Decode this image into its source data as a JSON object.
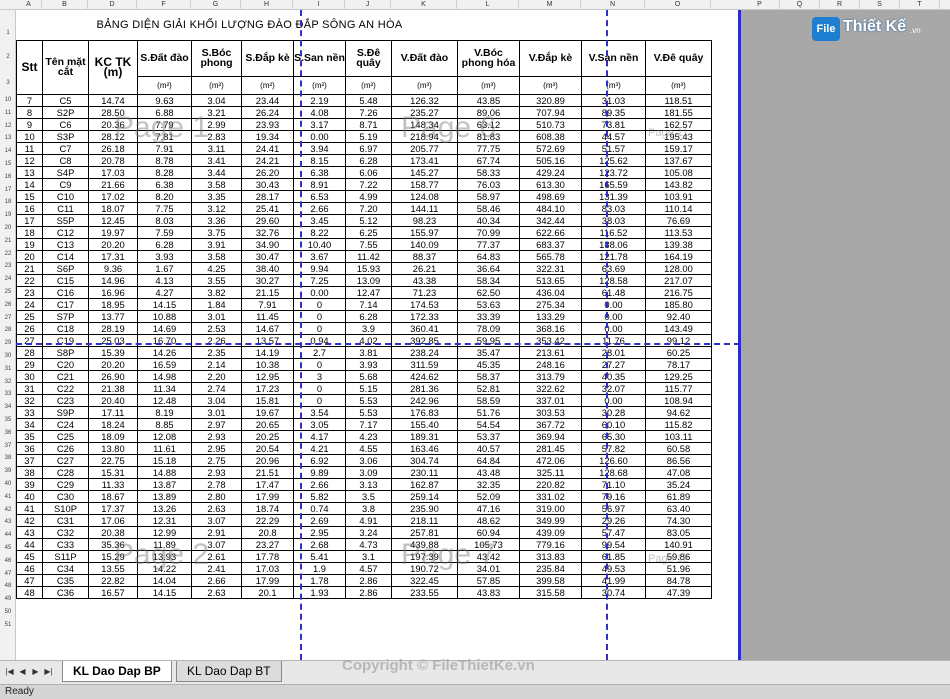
{
  "window": {
    "logo_badge": "File",
    "logo_text": "Thiết Kế",
    "logo_suffix": ".vn",
    "copyright": "Copyright © FileThietKe.vn"
  },
  "columns": [
    "A",
    "B",
    "D",
    "F",
    "G",
    "H",
    "I",
    "J",
    "K",
    "L",
    "M",
    "N",
    "O",
    "P",
    "Q",
    "R",
    "S",
    "T"
  ],
  "title": "BẢNG DIỆN GIẢI KHỐI LƯỢNG ĐÀO ĐẮP SÔNG AN HÒA",
  "headers": [
    "Stt",
    "Tên mặt cắt",
    "KC TK (m)",
    "S.Đất đào",
    "S.Bóc phong",
    "S.Đắp kè",
    "S.San nền",
    "S.Đê quây",
    "V.Đất đào",
    "V.Bóc phong hóa",
    "V.Đắp kè",
    "V.San nền",
    "V.Đê quây"
  ],
  "units": [
    "",
    "",
    "",
    "(m²)",
    "(m²)",
    "(m²)",
    "(m²)",
    "(m²)",
    "(m³)",
    "(m³)",
    "(m³)",
    "(m³)",
    "(m³)"
  ],
  "row_numbers": [
    "1",
    "2",
    "3",
    "10",
    "11",
    "12",
    "13",
    "14",
    "15",
    "16",
    "17",
    "18",
    "19",
    "20",
    "21",
    "22",
    "23",
    "24",
    "25",
    "26",
    "27",
    "28",
    "29",
    "30",
    "31",
    "32",
    "33",
    "34",
    "35",
    "36",
    "37",
    "38",
    "39",
    "40",
    "41",
    "42",
    "43",
    "44",
    "45",
    "46",
    "47",
    "48",
    "49",
    "50",
    "51"
  ],
  "rows": [
    [
      "7",
      "C5",
      "14.74",
      "9.63",
      "3.04",
      "23.44",
      "2.19",
      "5.48",
      "126.32",
      "43.85",
      "320.89",
      "31.03",
      "118.51"
    ],
    [
      "8",
      "S2P",
      "28.50",
      "6.88",
      "3.21",
      "26.24",
      "4.08",
      "7.26",
      "235.27",
      "89.06",
      "707.94",
      "89.35",
      "181.55"
    ],
    [
      "9",
      "C6",
      "20.36",
      "7.79",
      "2.99",
      "23.93",
      "3.17",
      "8.71",
      "148.34",
      "63.12",
      "510.73",
      "73.81",
      "162.57"
    ],
    [
      "10",
      "S3P",
      "28.12",
      "7.81",
      "2.83",
      "19.34",
      "0.00",
      "5.19",
      "218.94",
      "81.83",
      "608.38",
      "44.57",
      "195.43"
    ],
    [
      "11",
      "C7",
      "26.18",
      "7.91",
      "3.11",
      "24.41",
      "3.94",
      "6.97",
      "205.77",
      "77.75",
      "572.69",
      "51.57",
      "159.17"
    ],
    [
      "12",
      "C8",
      "20.78",
      "8.78",
      "3.41",
      "24.21",
      "8.15",
      "6.28",
      "173.41",
      "67.74",
      "505.16",
      "125.62",
      "137.67"
    ],
    [
      "13",
      "S4P",
      "17.03",
      "8.28",
      "3.44",
      "26.20",
      "6.38",
      "6.06",
      "145.27",
      "58.33",
      "429.24",
      "123.72",
      "105.08"
    ],
    [
      "14",
      "C9",
      "21.66",
      "6.38",
      "3.58",
      "30.43",
      "8.91",
      "7.22",
      "158.77",
      "76.03",
      "613.30",
      "165.59",
      "143.82"
    ],
    [
      "15",
      "C10",
      "17.02",
      "8.20",
      "3.35",
      "28.17",
      "6.53",
      "4.99",
      "124.08",
      "58.97",
      "498.69",
      "131.39",
      "103.91"
    ],
    [
      "16",
      "C11",
      "18.07",
      "7.75",
      "3.12",
      "25.41",
      "2.66",
      "7.20",
      "144.11",
      "58.46",
      "484.10",
      "83.03",
      "110.14"
    ],
    [
      "17",
      "S5P",
      "12.45",
      "8.03",
      "3.36",
      "29.60",
      "3.45",
      "5.12",
      "98.23",
      "40.34",
      "342.44",
      "38.03",
      "76.69"
    ],
    [
      "18",
      "C12",
      "19.97",
      "7.59",
      "3.75",
      "32.76",
      "8.22",
      "6.25",
      "155.97",
      "70.99",
      "622.66",
      "116.52",
      "113.53"
    ],
    [
      "19",
      "C13",
      "20.20",
      "6.28",
      "3.91",
      "34.90",
      "10.40",
      "7.55",
      "140.09",
      "77.37",
      "683.37",
      "188.06",
      "139.38"
    ],
    [
      "20",
      "C14",
      "17.31",
      "3.93",
      "3.58",
      "30.47",
      "3.67",
      "11.42",
      "88.37",
      "64.83",
      "565.78",
      "121.78",
      "164.19"
    ],
    [
      "21",
      "S6P",
      "9.36",
      "1.67",
      "4.25",
      "38.40",
      "9.94",
      "15.93",
      "26.21",
      "36.64",
      "322.31",
      "63.69",
      "128.00"
    ],
    [
      "22",
      "C15",
      "14.96",
      "4.13",
      "3.55",
      "30.27",
      "7.25",
      "13.09",
      "43.38",
      "58.34",
      "513.65",
      "128.58",
      "217.07"
    ],
    [
      "23",
      "C16",
      "16.96",
      "4.27",
      "3.82",
      "21.15",
      "0.00",
      "12.47",
      "71.23",
      "62.50",
      "436.04",
      "61.48",
      "216.75"
    ],
    [
      "24",
      "C17",
      "18.95",
      "14.15",
      "1.84",
      "7.91",
      "0",
      "7.14",
      "174.53",
      "53.63",
      "275.34",
      "0.00",
      "185.80"
    ],
    [
      "25",
      "S7P",
      "13.77",
      "10.88",
      "3.01",
      "11.45",
      "0",
      "6.28",
      "172.33",
      "33.39",
      "133.29",
      "0.00",
      "92.40"
    ],
    [
      "26",
      "C18",
      "28.19",
      "14.69",
      "2.53",
      "14.67",
      "0",
      "3.9",
      "360.41",
      "78.09",
      "368.16",
      "0.00",
      "143.49"
    ],
    [
      "27",
      "C19",
      "25.03",
      "16.70",
      "2.26",
      "13.57",
      "0.94",
      "4.02",
      "392.85",
      "59.95",
      "353.42",
      "11.76",
      "99.12"
    ],
    [
      "28",
      "S8P",
      "15.39",
      "14.26",
      "2.35",
      "14.19",
      "2.7",
      "3.81",
      "238.24",
      "35.47",
      "213.61",
      "28.01",
      "60.25"
    ],
    [
      "29",
      "C20",
      "20.20",
      "16.59",
      "2.14",
      "10.38",
      "0",
      "3.93",
      "311.59",
      "45.35",
      "248.16",
      "27.27",
      "78.17"
    ],
    [
      "30",
      "C21",
      "26.90",
      "14.98",
      "2.20",
      "12.95",
      "3",
      "5.68",
      "424.62",
      "58.37",
      "313.79",
      "40.35",
      "129.25"
    ],
    [
      "31",
      "C22",
      "21.38",
      "11.34",
      "2.74",
      "17.23",
      "0",
      "5.15",
      "281.36",
      "52.81",
      "322.62",
      "32.07",
      "115.77"
    ],
    [
      "32",
      "C23",
      "20.40",
      "12.48",
      "3.04",
      "15.81",
      "0",
      "5.53",
      "242.96",
      "58.59",
      "337.01",
      "0.00",
      "108.94"
    ],
    [
      "33",
      "S9P",
      "17.11",
      "8.19",
      "3.01",
      "19.67",
      "3.54",
      "5.53",
      "176.83",
      "51.76",
      "303.53",
      "30.28",
      "94.62"
    ],
    [
      "34",
      "C24",
      "18.24",
      "8.85",
      "2.97",
      "20.65",
      "3.05",
      "7.17",
      "155.40",
      "54.54",
      "367.72",
      "60.10",
      "115.82"
    ],
    [
      "35",
      "C25",
      "18.09",
      "12.08",
      "2.93",
      "20.25",
      "4.17",
      "4.23",
      "189.31",
      "53.37",
      "369.94",
      "65.30",
      "103.11"
    ],
    [
      "36",
      "C26",
      "13.80",
      "11.61",
      "2.95",
      "20.54",
      "4.21",
      "4.55",
      "163.46",
      "40.57",
      "281.45",
      "57.82",
      "60.58"
    ],
    [
      "37",
      "C27",
      "22.75",
      "15.18",
      "2.75",
      "20.96",
      "6.92",
      "3.06",
      "304.74",
      "64.84",
      "472.06",
      "126.60",
      "86.56"
    ],
    [
      "38",
      "C28",
      "15.31",
      "14.88",
      "2.93",
      "21.51",
      "9.89",
      "3.09",
      "230.11",
      "43.48",
      "325.11",
      "128.68",
      "47.08"
    ],
    [
      "39",
      "C29",
      "11.33",
      "13.87",
      "2.78",
      "17.47",
      "2.66",
      "3.13",
      "162.87",
      "32.35",
      "220.82",
      "71.10",
      "35.24"
    ],
    [
      "40",
      "C30",
      "18.67",
      "13.89",
      "2.80",
      "17.99",
      "5.82",
      "3.5",
      "259.14",
      "52.09",
      "331.02",
      "79.16",
      "61.89"
    ],
    [
      "41",
      "S10P",
      "17.37",
      "13.26",
      "2.63",
      "18.74",
      "0.74",
      "3.8",
      "235.90",
      "47.16",
      "319.00",
      "56.97",
      "63.40"
    ],
    [
      "42",
      "C31",
      "17.06",
      "12.31",
      "3.07",
      "22.29",
      "2.69",
      "4.91",
      "218.11",
      "48.62",
      "349.99",
      "29.26",
      "74.30"
    ],
    [
      "43",
      "C32",
      "20.38",
      "12.99",
      "2.91",
      "20.8",
      "2.95",
      "3.24",
      "257.81",
      "60.94",
      "439.09",
      "57.47",
      "83.05"
    ],
    [
      "44",
      "C33",
      "35.36",
      "11.89",
      "3.07",
      "23.27",
      "2.68",
      "4.73",
      "439.88",
      "105.73",
      "779.16",
      "99.54",
      "140.91"
    ],
    [
      "45",
      "S11P",
      "15.29",
      "13.93",
      "2.61",
      "17.78",
      "5.41",
      "3.1",
      "197.39",
      "43.42",
      "313.83",
      "61.85",
      "59.86"
    ],
    [
      "46",
      "C34",
      "13.55",
      "14.22",
      "2.41",
      "17.03",
      "1.9",
      "4.57",
      "190.72",
      "34.01",
      "235.84",
      "49.53",
      "51.96"
    ],
    [
      "47",
      "C35",
      "22.82",
      "14.04",
      "2.66",
      "17.99",
      "1.78",
      "2.86",
      "322.45",
      "57.85",
      "399.58",
      "41.99",
      "84.78"
    ],
    [
      "48",
      "C36",
      "16.57",
      "14.15",
      "2.63",
      "20.1",
      "1.93",
      "2.86",
      "233.55",
      "43.83",
      "315.58",
      "30.74",
      "47.39"
    ]
  ],
  "watermarks": [
    "Page 1",
    "Page 6",
    "Page 11",
    "Page 2",
    "Page 7",
    "Page 12"
  ],
  "sheet_tabs": [
    "KL Dao Dap BP",
    "KL Dao Dap BT"
  ],
  "status": "Ready"
}
